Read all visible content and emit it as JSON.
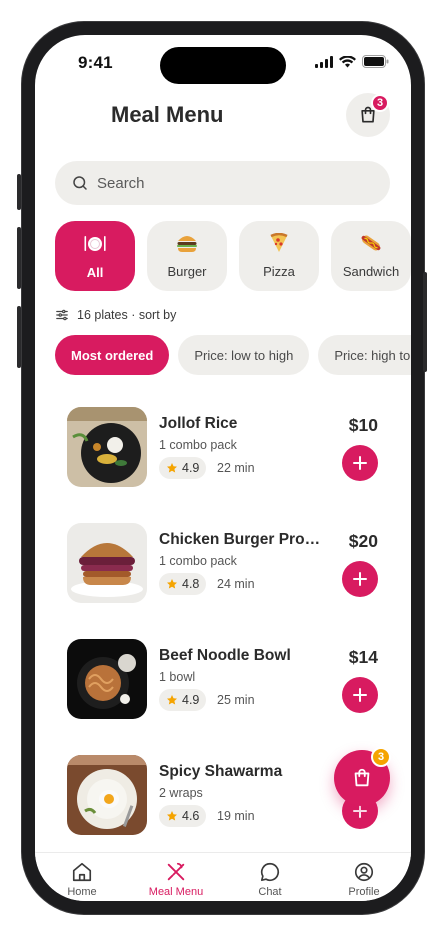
{
  "status_bar": {
    "time": "9:41"
  },
  "header": {
    "title": "Meal Menu",
    "cart_badge": "3"
  },
  "search": {
    "placeholder": "Search"
  },
  "categories": [
    {
      "label": "All",
      "icon": "plate-icon",
      "active": true
    },
    {
      "label": "Burger",
      "icon": "burger-icon"
    },
    {
      "label": "Pizza",
      "icon": "pizza-icon"
    },
    {
      "label": "Sandwich",
      "icon": "hotdog-icon"
    }
  ],
  "meta": {
    "text": "16 plates · sort by"
  },
  "sort_options": [
    {
      "label": "Most ordered",
      "active": true
    },
    {
      "label": "Price: low to high"
    },
    {
      "label": "Price: high to low"
    }
  ],
  "items": [
    {
      "name": "Jollof Rice",
      "sub": "1 combo pack",
      "rating": "4.9",
      "time": "22 min",
      "price": "$10"
    },
    {
      "name": "Chicken Burger Promo Pack",
      "sub": "1 combo pack",
      "rating": "4.8",
      "time": "24 min",
      "price": "$20"
    },
    {
      "name": "Beef Noodle Bowl",
      "sub": "1 bowl",
      "rating": "4.9",
      "time": "25 min",
      "price": "$14"
    },
    {
      "name": "Spicy Shawarma",
      "sub": "2 wraps",
      "rating": "4.6",
      "time": "19 min",
      "price": ""
    }
  ],
  "fab": {
    "badge": "3"
  },
  "tabs": [
    {
      "label": "Home",
      "icon": "home-icon"
    },
    {
      "label": "Meal Menu",
      "icon": "utensils-icon",
      "active": true
    },
    {
      "label": "Chat",
      "icon": "chat-icon"
    },
    {
      "label": "Profile",
      "icon": "profile-icon"
    }
  ],
  "colors": {
    "accent": "#d81b60",
    "chip_bg": "#efeeeb",
    "badge_orange": "#f5a400"
  }
}
